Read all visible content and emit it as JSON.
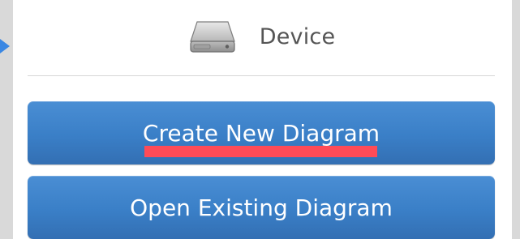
{
  "header": {
    "icon": "hard-drive-icon",
    "label": "Device"
  },
  "buttons": {
    "create_label": "Create New Diagram",
    "open_label": "Open Existing Diagram"
  },
  "colors": {
    "button_blue": "#3a7fc7",
    "highlight_red": "#ff4b57",
    "pointer_blue": "#3a87e3"
  }
}
